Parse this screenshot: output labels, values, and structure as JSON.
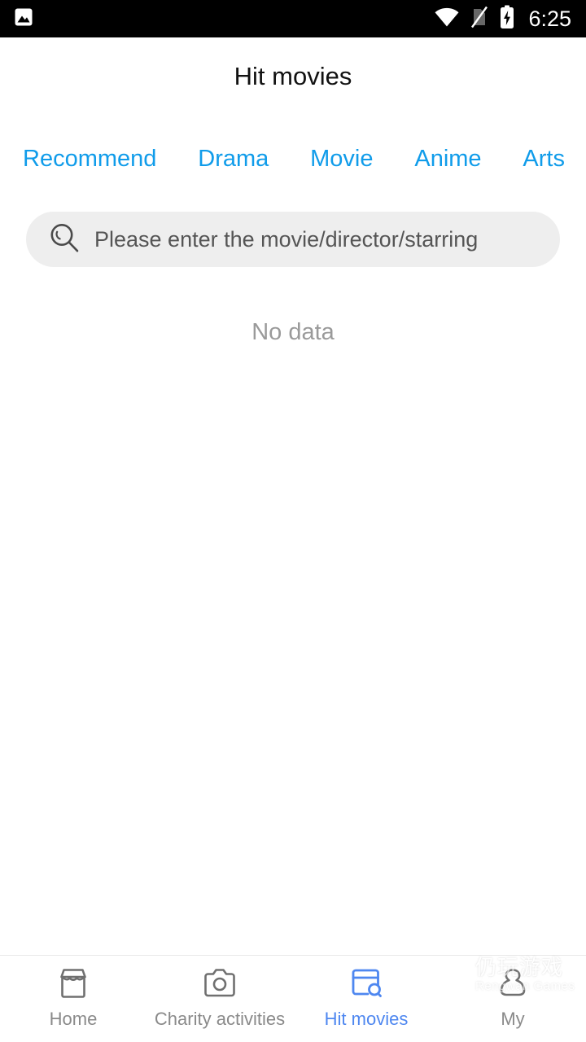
{
  "status_bar": {
    "notification_icon": "image-icon",
    "wifi_icon": "wifi-icon",
    "sim_icon": "no-sim-icon",
    "battery_icon": "battery-charging-icon",
    "time": "6:25",
    "background_color": "#000000",
    "foreground_color": "#ffffff"
  },
  "header": {
    "title": "Hit movies"
  },
  "tabs": {
    "active_color": "#109cea",
    "items": [
      {
        "label": "Recommend"
      },
      {
        "label": "Drama"
      },
      {
        "label": "Movie"
      },
      {
        "label": "Anime"
      },
      {
        "label": "Arts"
      }
    ]
  },
  "search": {
    "icon": "search-icon",
    "placeholder": "Please enter the movie/director/starring",
    "value": "",
    "background_color": "#eeeeee"
  },
  "content": {
    "empty_text": "No data"
  },
  "bottom_nav": {
    "active_color": "#4e87f0",
    "inactive_color": "#8a8a8a",
    "items": [
      {
        "label": "Home",
        "icon": "store-icon",
        "active": false
      },
      {
        "label": "Charity activities",
        "icon": "camera-icon",
        "active": false
      },
      {
        "label": "Hit movies",
        "icon": "browser-search-icon",
        "active": true
      },
      {
        "label": "My",
        "icon": "user-icon",
        "active": false
      }
    ]
  },
  "watermark": {
    "logo": "rengwan-logo-icon",
    "text_cn": "仍玩游戏",
    "text_en": "Rengwan Games"
  }
}
